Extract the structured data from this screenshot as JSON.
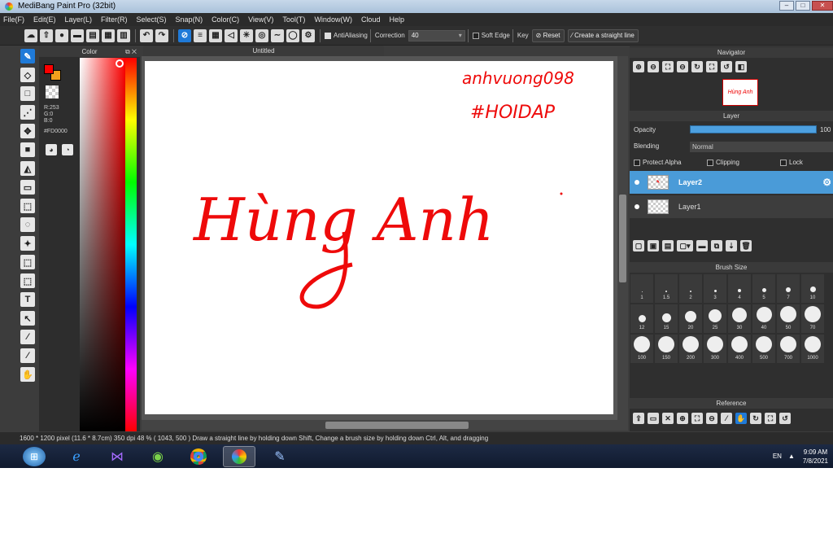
{
  "window": {
    "title": "MediBang Paint Pro (32bit)",
    "minimize": "–",
    "maximize": "□",
    "close": "✕"
  },
  "menu": [
    "File(F)",
    "Edit(E)",
    "Layer(L)",
    "Filter(R)",
    "Select(S)",
    "Snap(N)",
    "Color(C)",
    "View(V)",
    "Tool(T)",
    "Window(W)",
    "Cloud",
    "Help"
  ],
  "toolbar": {
    "antialiasing_label": "AntiAliasing",
    "correction_label": "Correction",
    "correction_value": "40",
    "soft_edge_label": "Soft Edge",
    "key_label": "Key",
    "reset_label": "Reset",
    "straight_line_label": "Create a straight line"
  },
  "color_panel": {
    "title": "Color",
    "r": "R:253",
    "g": "G:0",
    "b": "B:0",
    "hex": "#FD0000",
    "fg_color": "#FD0000",
    "bg_color": "#F2A01C"
  },
  "document": {
    "tab_title": "Untitled",
    "canvas_text_1": "Hùng Anh",
    "canvas_text_2": "anhvuong098",
    "canvas_text_3": "#HOIDAP"
  },
  "navigator": {
    "title": "Navigator",
    "thumb_text": "Hùng Anh"
  },
  "layer_panel": {
    "title": "Layer",
    "opacity_label": "Opacity",
    "opacity_value": "100",
    "opacity_fraction": 1.0,
    "blending_label": "Blending",
    "blending_value": "Normal",
    "protect_alpha": "Protect Alpha",
    "clipping": "Clipping",
    "lock": "Lock",
    "layers": [
      {
        "name": "Layer2",
        "selected": true
      },
      {
        "name": "Layer1",
        "selected": false
      }
    ]
  },
  "brush_size": {
    "title": "Brush Size",
    "sizes": [
      "1",
      "1.5",
      "2",
      "3",
      "4",
      "5",
      "7",
      "10",
      "12",
      "15",
      "20",
      "25",
      "30",
      "40",
      "50",
      "70",
      "100",
      "150",
      "200",
      "300",
      "400",
      "500",
      "700",
      "1000"
    ]
  },
  "reference": {
    "title": "Reference"
  },
  "status": {
    "text": "1600 * 1200 pixel  (11.6 * 8.7cm)  350 dpi  48 %  ( 1043, 500 )  Draw a straight line by holding down Shift, Change a brush size by holding down Ctrl, Alt, and dragging"
  },
  "taskbar": {
    "lang": "EN",
    "time": "9:09 AM",
    "date": "7/8/2021"
  }
}
